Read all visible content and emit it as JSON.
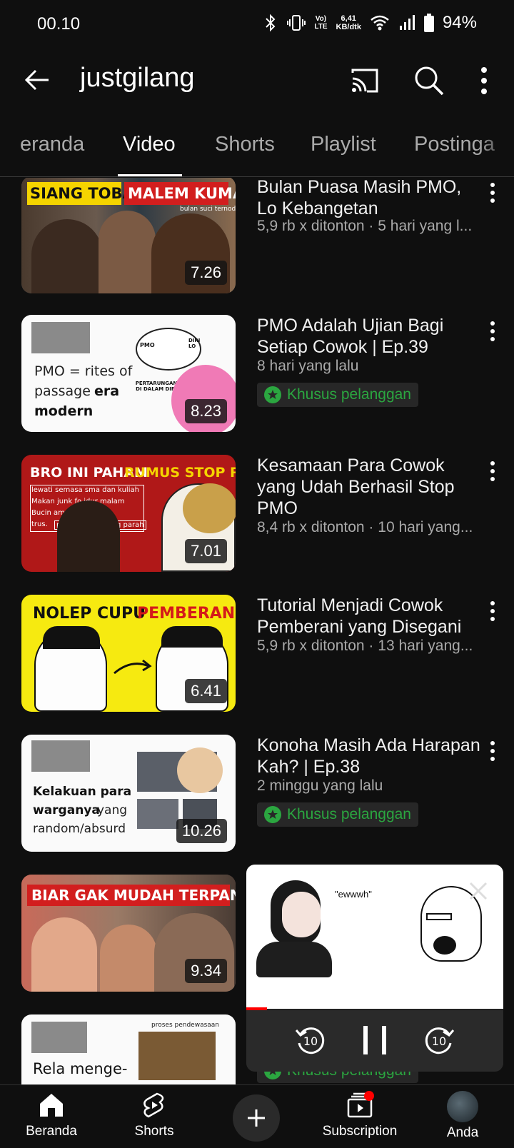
{
  "status_bar": {
    "time": "00.10",
    "volte_top": "Vo)",
    "volte_bottom": "LTE",
    "net_speed_value": "6,41",
    "net_speed_unit": "KB/dtk",
    "battery": "94%"
  },
  "app_bar": {
    "title": "justgilang",
    "back_icon": "arrow-left-icon",
    "cast_icon": "cast-icon",
    "search_icon": "search-icon",
    "more_icon": "more-vert-icon"
  },
  "tabs": [
    {
      "label": "eranda"
    },
    {
      "label": "Video",
      "active": true
    },
    {
      "label": "Shorts"
    },
    {
      "label": "Playlist"
    },
    {
      "label": "Postinga"
    }
  ],
  "videos": [
    {
      "title": "Bulan Puasa Masih PMO, Lo Kebangetan",
      "meta": "5,9 rb x ditonton · 5 hari yang l...",
      "duration": "7.26",
      "thumb_text_1": "SIANG TOBAT",
      "thumb_text_2": "MALEM KUMAT",
      "thumb_text_3": "bulan suci ternodai"
    },
    {
      "title": "PMO Adalah Ujian Bagi Setiap Cowok | Ep.39",
      "meta": "8 hari yang lalu",
      "badge": "Khusus pelanggan",
      "duration": "8.23",
      "thumb_text_1": "PMO = rites of",
      "thumb_text_2": "passage",
      "thumb_text_3": "era",
      "thumb_text_4": "modern",
      "thumb_text_5": "PMO",
      "thumb_text_6": "DIRI LO",
      "thumb_text_7": "PERTARUNGAN DI DALAM DIRI"
    },
    {
      "title": "Kesamaan Para Cowok yang Udah Berhasil Stop PMO",
      "meta": "8,4 rb x ditonton · 10 hari yang...",
      "duration": "7.01",
      "thumb_text_1": "BRO INI PAHAM",
      "thumb_text_2": "RUMUS STOP PMO",
      "thumb_text_3": "lewati semasa sma dan kuliah",
      "thumb_text_4": "Makan junk fo    idur malam",
      "thumb_text_5": "Bucin amp      g takut",
      "thumb_text_6": "trus.",
      "thumb_text_7": "pmo",
      "thumb_text_8": "g parah"
    },
    {
      "title": "Tutorial Menjadi Cowok Pemberani yang Disegani",
      "meta": "5,9 rb x ditonton · 13 hari yang...",
      "duration": "6.41",
      "thumb_text_1": "NOLEP CUPU",
      "thumb_text_2": "PEMBERANI"
    },
    {
      "title": "Konoha Masih Ada Harapan Kah? | Ep.38",
      "meta": "2 minggu yang lalu",
      "badge": "Khusus pelanggan",
      "duration": "10.26",
      "thumb_text_1": "Kelakuan para",
      "thumb_text_2": "warganya",
      "thumb_text_3": "yang",
      "thumb_text_4": "random/absurd"
    },
    {
      "title": "",
      "meta": "",
      "duration": "9.34",
      "thumb_text_1": "BIAR GAK MUDAH TERPANCING"
    },
    {
      "title": "",
      "meta": "",
      "badge": "Khusus pelanggan",
      "thumb_text_1": "proses pendewasaan",
      "thumb_text_2": "Rela menge-"
    }
  ],
  "mini_player": {
    "caption": "\"ewwwh\"",
    "progress": 0.08,
    "rewind_label": "10",
    "forward_label": "10"
  },
  "bottom_nav": [
    {
      "label": "Beranda",
      "icon": "home-icon"
    },
    {
      "label": "Shorts",
      "icon": "shorts-icon"
    },
    {
      "label": "",
      "icon": "plus-icon"
    },
    {
      "label": "Subscription",
      "icon": "subscriptions-icon"
    },
    {
      "label": "Anda",
      "icon": "avatar"
    }
  ],
  "colors": {
    "background": "#0f0f0f",
    "badge_green": "#2ba640",
    "progress_red": "#ff0000"
  }
}
